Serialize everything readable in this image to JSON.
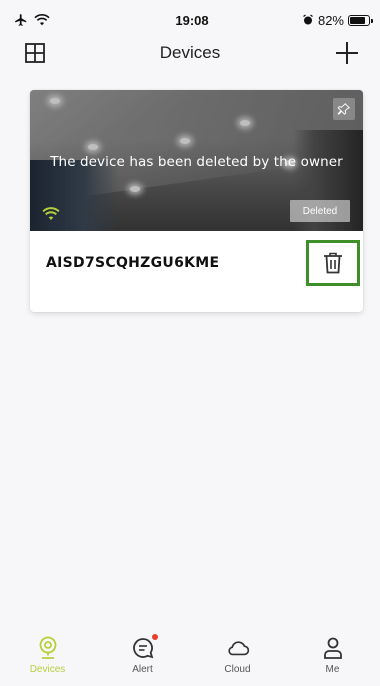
{
  "status_bar": {
    "time": "19:08",
    "battery_percent": "82%",
    "battery_level": 0.82
  },
  "header": {
    "title": "Devices",
    "left_icon": "grid-icon",
    "right_icon": "plus-icon"
  },
  "device_card": {
    "thumbnail_message": "The device has been deleted by the owner",
    "status_badge": "Deleted",
    "device_id": "AISD7SCQHZGU6KME",
    "delete_icon": "trash-icon",
    "highlight_color": "#3e8f2a"
  },
  "bottom_nav": {
    "items": [
      {
        "label": "Devices",
        "icon": "camera-icon",
        "active": true
      },
      {
        "label": "Alert",
        "icon": "message-icon",
        "badge": true
      },
      {
        "label": "Cloud",
        "icon": "cloud-icon"
      },
      {
        "label": "Me",
        "icon": "person-icon"
      }
    ],
    "active_color": "#b6cf3d",
    "badge_color": "#e8402f"
  }
}
